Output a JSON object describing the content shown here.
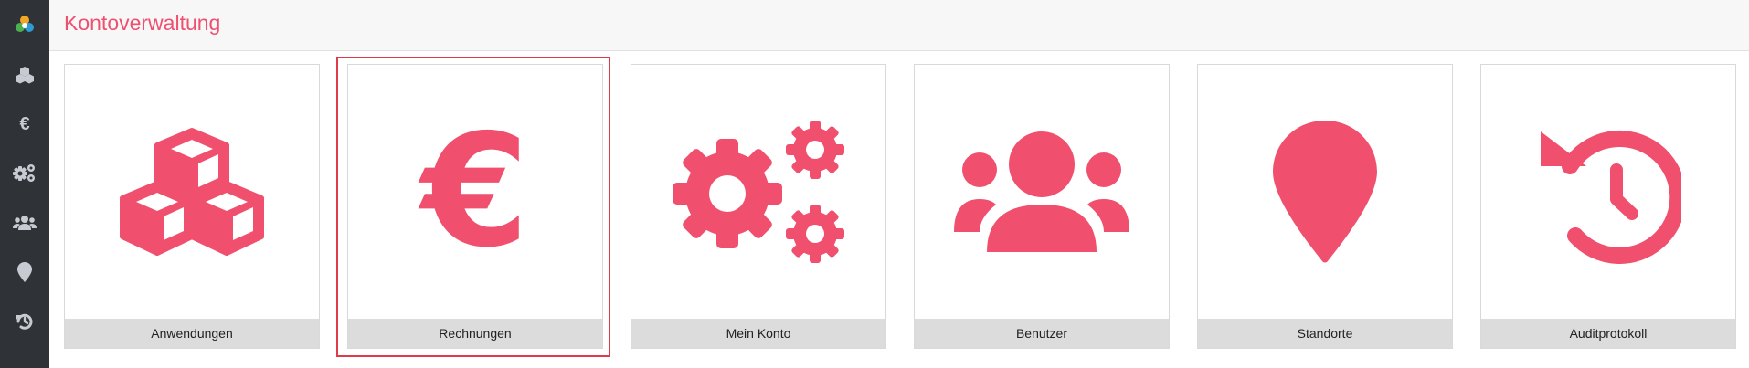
{
  "header": {
    "title": "Kontoverwaltung"
  },
  "sidebar": {
    "items": [
      {
        "name": "logo",
        "icon": "app-logo-icon"
      },
      {
        "name": "anwendungen",
        "icon": "cubes-icon"
      },
      {
        "name": "rechnungen",
        "icon": "euro-icon",
        "glyph": "€"
      },
      {
        "name": "mein-konto",
        "icon": "gears-icon"
      },
      {
        "name": "benutzer",
        "icon": "users-icon"
      },
      {
        "name": "standorte",
        "icon": "map-marker-icon"
      },
      {
        "name": "auditprotokoll",
        "icon": "history-icon"
      }
    ]
  },
  "tiles": [
    {
      "label": "Anwendungen",
      "icon": "cubes-icon"
    },
    {
      "label": "Rechnungen",
      "icon": "euro-icon",
      "glyph": "€",
      "selected": true
    },
    {
      "label": "Mein Konto",
      "icon": "gears-icon"
    },
    {
      "label": "Benutzer",
      "icon": "users-icon"
    },
    {
      "label": "Standorte",
      "icon": "map-marker-icon"
    },
    {
      "label": "Auditprotokoll",
      "icon": "history-icon"
    }
  ],
  "colors": {
    "accent": "#f04f6d",
    "sidebar_bg": "#2f3237",
    "sidebar_icon": "#c7cbd1",
    "selection_border": "#e03a4b",
    "tile_label_bg": "#dcdcdc"
  }
}
